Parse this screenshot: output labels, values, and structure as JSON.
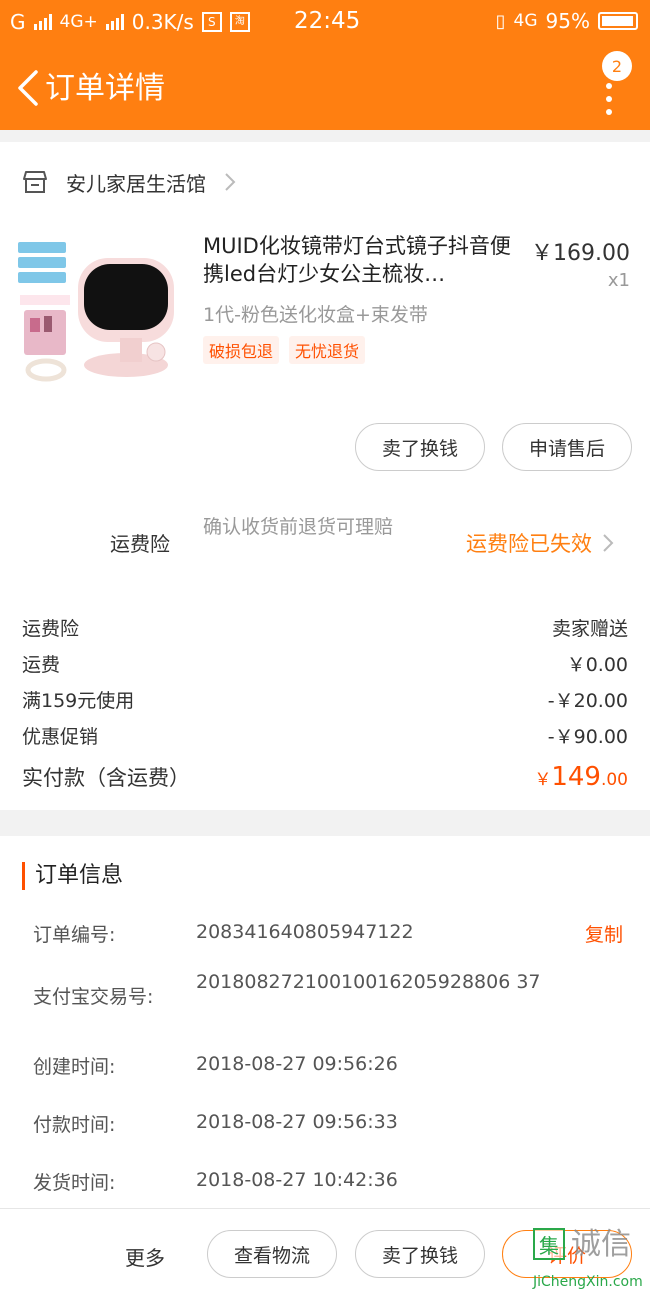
{
  "status_bar": {
    "carrier": "G",
    "network1": "4G+",
    "speed": "0.3K/s",
    "icon_s": "S",
    "icon_tb": "淘",
    "time": "22:45",
    "network2": "4G",
    "battery": "95%"
  },
  "header": {
    "title": "订单详情",
    "badge_count": "2",
    "accent_color": "#ff7f11"
  },
  "shop": {
    "name": "安儿家居生活馆"
  },
  "product": {
    "title": "MUID化妆镜带灯台式镜子抖音便携led台灯少女公主梳妆…",
    "price": "￥169.00",
    "quantity": "x1",
    "sku": "1代-粉色送化妆盒+束发带",
    "tags": [
      "破损包退",
      "无忧退货"
    ],
    "image_labels": [
      "五年质保",
      "全国联保",
      "不喜欢包退",
      "送化妆盒+束发带"
    ]
  },
  "product_actions": {
    "sell": "卖了换钱",
    "after_sale": "申请售后"
  },
  "insurance": {
    "label": "运费险",
    "desc": "确认收货前退货可理赔",
    "status": "运费险已失效"
  },
  "fees": [
    {
      "label": "运费险",
      "value": "卖家赠送"
    },
    {
      "label": "运费",
      "value": "￥0.00"
    },
    {
      "label": "满159元使用",
      "value": "-￥20.00"
    },
    {
      "label": "优惠促销",
      "value": "-￥90.00"
    }
  ],
  "total": {
    "label": "实付款（含运费）",
    "currency": "￥",
    "integer": "149",
    "decimal": ".00"
  },
  "order_info": {
    "title": "订单信息",
    "copy_label": "复制",
    "rows": [
      {
        "label": "订单编号:",
        "value": "208341640805947122"
      },
      {
        "label": "支付宝交易号:",
        "value": "20180827210010016205928806 37"
      },
      {
        "label": "创建时间:",
        "value": "2018-08-27 09:56:26"
      },
      {
        "label": "付款时间:",
        "value": "2018-08-27 09:56:33"
      },
      {
        "label": "发货时间:",
        "value": "2018-08-27 10:42:36"
      }
    ]
  },
  "bottom_bar": {
    "more": "更多",
    "logistics": "查看物流",
    "sell": "卖了换钱",
    "review": "评价"
  },
  "watermark": {
    "char": "集",
    "text": "诚信",
    "url": "JiChengXin.com"
  }
}
